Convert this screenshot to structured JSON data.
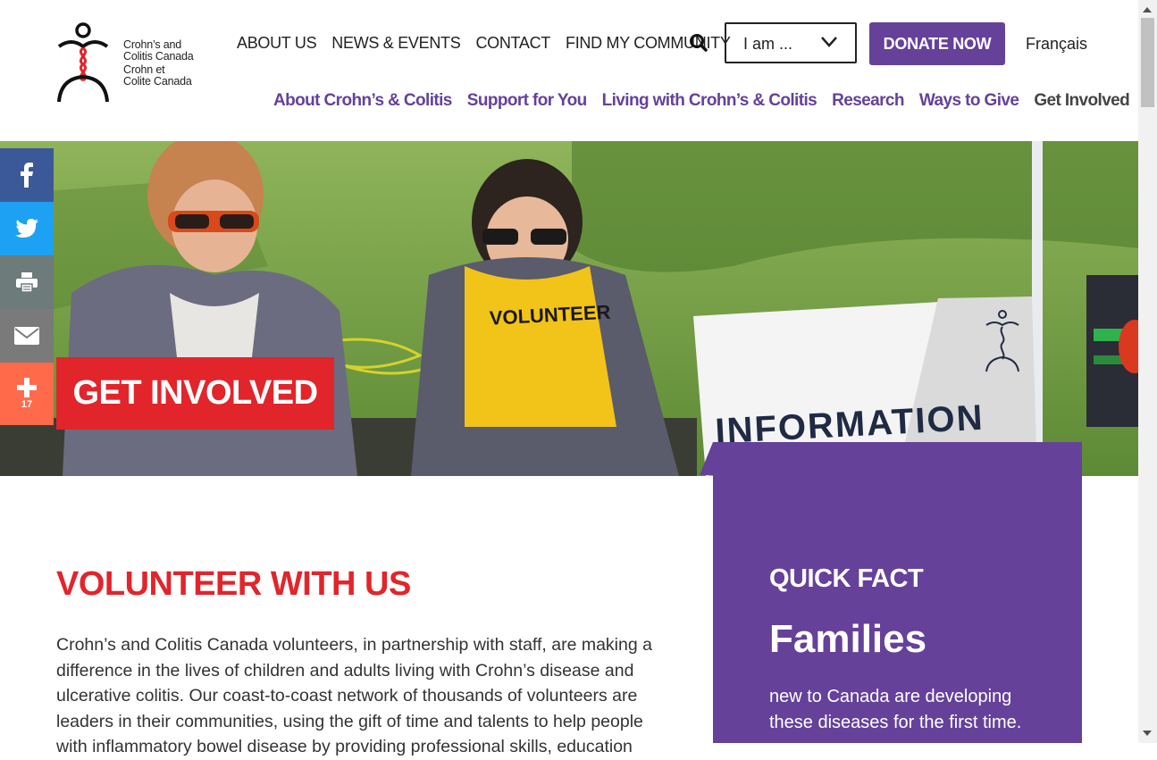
{
  "logo": {
    "lines_en": [
      "Crohn’s and",
      "Colitis Canada"
    ],
    "lines_fr": [
      "Crohn et",
      "Colite Canada"
    ]
  },
  "util_nav": [
    "ABOUT US",
    "NEWS & EVENTS",
    "CONTACT",
    "FIND MY COMMUNITY"
  ],
  "search": {
    "icon": "search-icon"
  },
  "iam_select": {
    "value": "I am ..."
  },
  "donate_label": "DONATE NOW",
  "lang_label": "Français",
  "main_nav": [
    "About Crohn’s & Colitis",
    "Support for You",
    "Living with Crohn’s & Colitis",
    "Research",
    "Ways to Give",
    "Get Involved"
  ],
  "hero": {
    "title": "GET INVOLVED",
    "shirt_text": "VOLUNTEER",
    "sign_text": "INFORMATION"
  },
  "share": {
    "buttons": [
      "facebook-icon",
      "twitter-icon",
      "print-icon",
      "email-icon",
      "plus-icon"
    ],
    "count": "17"
  },
  "content": {
    "title": "VOLUNTEER WITH US",
    "body": "Crohn’s and Colitis Canada volunteers, in partnership with staff, are making a difference in the lives of children and adults living with Crohn’s disease and ulcerative colitis. Our coast-to-coast network of thousands of volunteers are leaders in their communities, using the gift of time and talents to help people with inflammatory bowel disease by providing professional skills, education"
  },
  "quick_fact": {
    "label": "QUICK FACT",
    "headline": "Families",
    "text": "new to Canada are developing these diseases for the first time."
  },
  "colors": {
    "purple": "#65419a",
    "red": "#e1252b",
    "facebook": "#3b5998",
    "twitter": "#1da1f2",
    "share_more": "#ff6b4a"
  }
}
